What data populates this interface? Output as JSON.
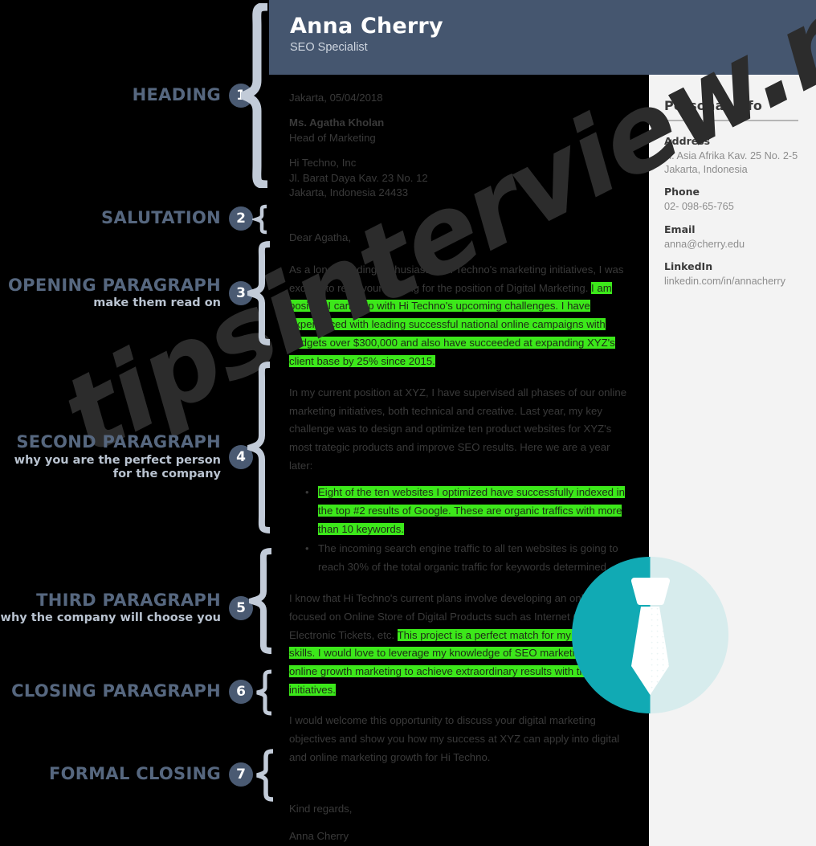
{
  "colors": {
    "page_bg": "#000000",
    "header_bg": "#45566f",
    "sidebar_bg": "#f3f3f3",
    "guide_label": "#56677f",
    "guide_sublabel": "#b9c3d0",
    "number_badge": "#4a5a72",
    "brace": "#c2cbd8",
    "highlight": "#3ce81a",
    "body_text": "#3a3a3a",
    "tie_teal": "#11aab4",
    "tie_teal_light": "#d7eced",
    "watermark": "#2c2c2c"
  },
  "watermark": {
    "text": "tipsinterview.net"
  },
  "header": {
    "name": "Anna Cherry",
    "role": "SEO Specialist"
  },
  "guides": [
    {
      "num": "1",
      "label": "HEADING",
      "sub": ""
    },
    {
      "num": "2",
      "label": "SALUTATION",
      "sub": ""
    },
    {
      "num": "3",
      "label": "OPENING PARAGRAPH",
      "sub": "make them read on"
    },
    {
      "num": "4",
      "label": "SECOND PARAGRAPH",
      "sub": "why you are the perfect person\nfor the company"
    },
    {
      "num": "5",
      "label": "THIRD PARAGRAPH",
      "sub": "why the company will choose you"
    },
    {
      "num": "6",
      "label": "CLOSING PARAGRAPH",
      "sub": ""
    },
    {
      "num": "7",
      "label": "FORMAL CLOSING",
      "sub": ""
    }
  ],
  "letter": {
    "date_line": "Jakarta, 05/04/2018",
    "recipient_name": "Ms. Agatha Kholan",
    "recipient_title": "Head of Marketing",
    "company_name": "Hi Techno, Inc",
    "company_street": "Jl. Barat Daya Kav. 23 No. 12",
    "company_city": "Jakarta, Indonesia 24433",
    "salutation": "Dear Agatha,",
    "p1_plain": "As a long-standing enthusiast of Hi Techno's marketing initiatives, I was excited to read your posting for the position of Digital Marketing. ",
    "p1_highlight": "I am positive I can help with Hi Techno's upcoming challenges. I have experienced with leading successful national online campaigns with budgets over $300,000 and also have succeeded at expanding XYZ's client base by 25% since 2015.",
    "p2": "In my current position at XYZ, I have supervised all phases of our online marketing initiatives, both technical and creative. Last year, my key challenge was to design and optimize ten product websites for XYZ's most trategic products and improve SEO results. Here we are a year later:",
    "bullet1_highlight": "Eight of the ten websites I optimized have successfully indexed in the top #2 results of Google. These are organic traffics with more than 10 keywords.",
    "bullet2": "The incoming search engine traffic to all ten websites is going to reach 30% of the total organic traffic for keywords determined.",
    "p3_plain": "I know that Hi Techno's current plans involve developing an online portal focused on Online Store of Digital Products such as Internet Coupons, Electronic Tickets, etc. ",
    "p3_highlight": "This project is a perfect match for my personal skills. I would love to leverage my knowledge of SEO marketing and online growth marketing to achieve extraordinary results with this initiatives.",
    "p4": "I would welcome this opportunity to discuss your digital marketing objectives and show you how my success at XYZ can apply into digital and online marketing growth for Hi Techno.",
    "closing_line": "Kind regards,",
    "signature": "Anna Cherry"
  },
  "sidebar": {
    "title": "Personal Info",
    "blocks": [
      {
        "label": "Address",
        "value": "Jl. Asia Afrika Kav. 25 No. 2-5\nJakarta, Indonesia"
      },
      {
        "label": "Phone",
        "value": "02- 098-65-765"
      },
      {
        "label": "Email",
        "value": "anna@cherry.edu"
      },
      {
        "label": "LinkedIn",
        "value": "linkedin.com/in/annacherry"
      }
    ]
  }
}
